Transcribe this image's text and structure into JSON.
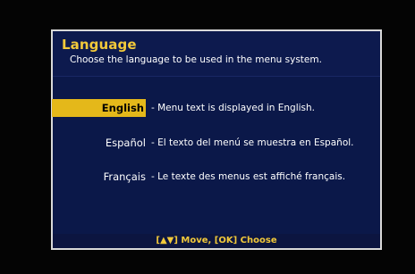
{
  "dialog": {
    "title": "Language",
    "subtitle": "Choose the language to be used in the menu system."
  },
  "languages": [
    {
      "name": "English",
      "description": "- Menu text is displayed in English.",
      "selected": true
    },
    {
      "name": "Español",
      "description": "- El texto del menú se muestra en Español.",
      "selected": false
    },
    {
      "name": "Français",
      "description": "- Le texte des menus est affiché français.",
      "selected": false
    }
  ],
  "footer": {
    "help": "[▲▼] Move, [OK] Choose"
  },
  "colors": {
    "background": "#040404",
    "panel": "#0b1849",
    "accent": "#f2c93a",
    "selection": "#e4b81a",
    "border": "#d9d9d9"
  }
}
